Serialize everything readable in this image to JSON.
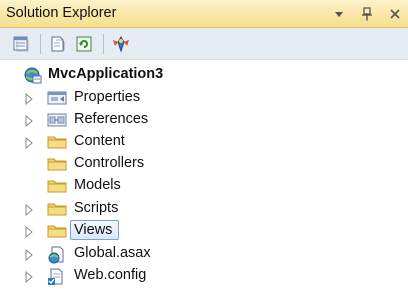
{
  "window": {
    "title": "Solution Explorer"
  },
  "controls": {
    "dropdown_icon": "dropdown-arrow-icon",
    "pin_icon": "pin-icon",
    "close_icon": "close-icon"
  },
  "toolbar": {
    "buttons": [
      {
        "name": "properties-window-icon"
      },
      {
        "name": "show-all-files-icon"
      },
      {
        "name": "refresh-icon"
      },
      {
        "name": "class-diagram-icon"
      }
    ]
  },
  "tree": {
    "root": {
      "label": "MvcApplication3",
      "icon": "mvc-project-icon"
    },
    "items": [
      {
        "label": "Properties",
        "icon": "properties-icon",
        "expandable": true
      },
      {
        "label": "References",
        "icon": "references-icon",
        "expandable": true
      },
      {
        "label": "Content",
        "icon": "folder-icon",
        "expandable": true
      },
      {
        "label": "Controllers",
        "icon": "folder-icon",
        "expandable": false
      },
      {
        "label": "Models",
        "icon": "folder-icon",
        "expandable": false
      },
      {
        "label": "Scripts",
        "icon": "folder-icon",
        "expandable": true
      },
      {
        "label": "Views",
        "icon": "folder-icon",
        "expandable": true,
        "selected": true
      },
      {
        "label": "Global.asax",
        "icon": "global-asax-icon",
        "expandable": true
      },
      {
        "label": "Web.config",
        "icon": "web-config-icon",
        "expandable": true
      }
    ]
  },
  "colors": {
    "titlebar_top": "#fcf3c9",
    "titlebar_bottom": "#f7dd8d",
    "toolbar_bg": "#e7ebf2",
    "folder": "#e8c55a",
    "selection_border": "#7da2ce"
  }
}
